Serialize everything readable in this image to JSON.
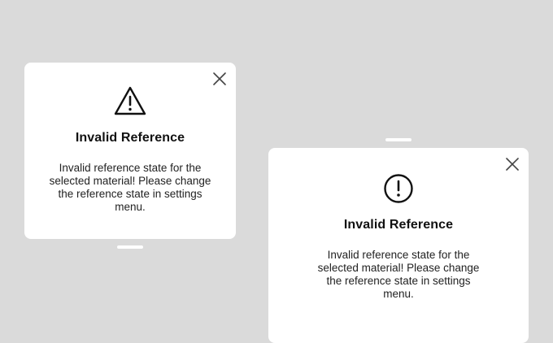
{
  "dialogs": [
    {
      "variant": "warning",
      "icon": "warning-triangle-icon",
      "title": "Invalid Reference",
      "message": "Invalid reference state for the selected material! Please change the reference state in settings menu."
    },
    {
      "variant": "error",
      "icon": "exclamation-circle-icon",
      "title": "Invalid Reference",
      "message": "Invalid reference state for the selected material! Please change the reference state in settings menu."
    }
  ],
  "colors": {
    "background": "#dadada",
    "surface": "#ffffff",
    "text": "#111111",
    "icon": "#111111"
  }
}
